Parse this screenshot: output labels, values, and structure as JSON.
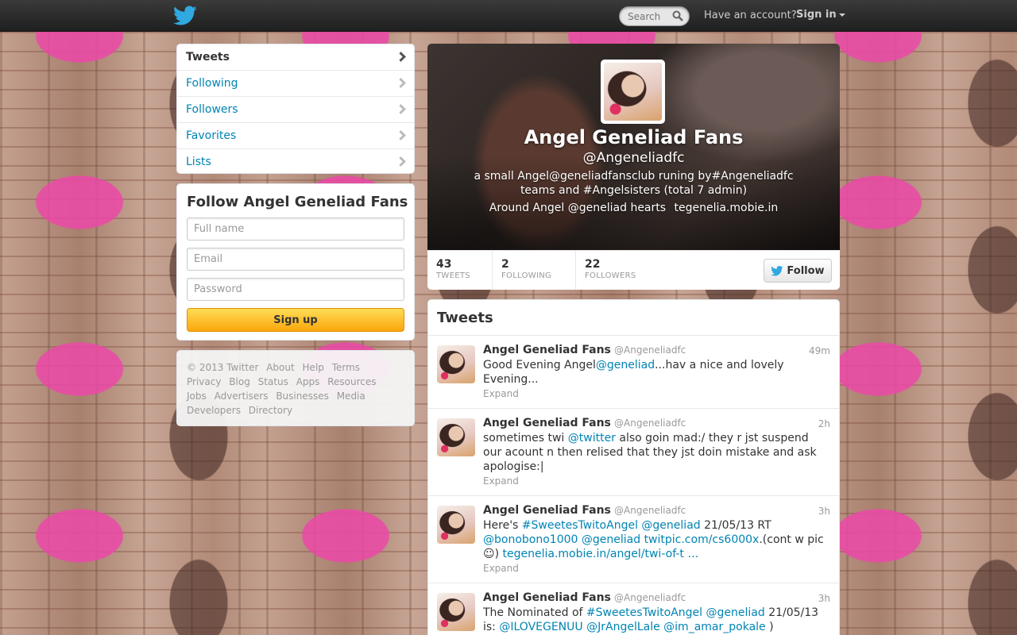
{
  "topbar": {
    "search_placeholder": "Search",
    "have_account": "Have an account?",
    "sign_in": "Sign in"
  },
  "nav": {
    "items": [
      {
        "label": "Tweets"
      },
      {
        "label": "Following"
      },
      {
        "label": "Followers"
      },
      {
        "label": "Favorites"
      },
      {
        "label": "Lists"
      }
    ]
  },
  "signup": {
    "title": "Follow Angel Geneliad Fans",
    "fullname_placeholder": "Full name",
    "email_placeholder": "Email",
    "password_placeholder": "Password",
    "button": "Sign up"
  },
  "footer": {
    "links": [
      "© 2013 Twitter",
      "About",
      "Help",
      "Terms",
      "Privacy",
      "Blog",
      "Status",
      "Apps",
      "Resources",
      "Jobs",
      "Advertisers",
      "Businesses",
      "Media",
      "Developers",
      "Directory"
    ]
  },
  "profile": {
    "name": "Angel Geneliad Fans",
    "handle": "@Angeneliadfc",
    "bio": "a small Angel@geneliadfansclub runing by#Angeneliadfc teams and #Angelsisters (total 7 admin)",
    "location": "Around Angel @geneliad hearts",
    "website": "tegenelia.mobie.in",
    "stats": [
      {
        "num": "43",
        "label": "TWEETS"
      },
      {
        "num": "2",
        "label": "FOLLOWING"
      },
      {
        "num": "22",
        "label": "FOLLOWERS"
      }
    ],
    "follow_button": "Follow"
  },
  "tweets": {
    "title": "Tweets",
    "items": [
      {
        "name": "Angel Geneliad Fans",
        "screen": "@Angeneliadfc",
        "time": "49m",
        "parts": [
          {
            "t": "Good Evening Angel"
          },
          {
            "t": "@geneliad",
            "link": true
          },
          {
            "t": "...hav a nice and lovely Evening..."
          }
        ],
        "expand": "Expand"
      },
      {
        "name": "Angel Geneliad Fans",
        "screen": "@Angeneliadfc",
        "time": "2h",
        "parts": [
          {
            "t": "sometimes twi "
          },
          {
            "t": "@twitter",
            "link": true
          },
          {
            "t": " also goin mad:/ they r jst suspend our acount n then relised that they jst doin mistake and ask apologise:|"
          }
        ],
        "expand": "Expand"
      },
      {
        "name": "Angel Geneliad Fans",
        "screen": "@Angeneliadfc",
        "time": "3h",
        "parts": [
          {
            "t": "Here's "
          },
          {
            "t": "#SweetesTwitoAngel",
            "link": true
          },
          {
            "t": " "
          },
          {
            "t": "@geneliad",
            "link": true
          },
          {
            "t": " 21/05/13 RT "
          },
          {
            "t": "@bonobono1000",
            "link": true
          },
          {
            "t": " "
          },
          {
            "t": "@geneliad",
            "link": true
          },
          {
            "t": " "
          },
          {
            "t": "twitpic.com/cs6000x",
            "link": true
          },
          {
            "t": ".(cont w pic☺) "
          },
          {
            "t": "tegenelia.mobie.in/angel/twi-of-t …",
            "link": true
          }
        ],
        "expand": "Expand"
      },
      {
        "name": "Angel Geneliad Fans",
        "screen": "@Angeneliadfc",
        "time": "3h",
        "parts": [
          {
            "t": "The Nominated of "
          },
          {
            "t": "#SweetesTwitoAngel",
            "link": true
          },
          {
            "t": " "
          },
          {
            "t": "@geneliad",
            "link": true
          },
          {
            "t": " 21/05/13 is: "
          },
          {
            "t": "@ILOVEGENUU",
            "link": true
          },
          {
            "t": " "
          },
          {
            "t": "@JrAngelLale",
            "link": true
          },
          {
            "t": " "
          },
          {
            "t": "@im_amar_pokale",
            "link": true
          },
          {
            "t": " )"
          }
        ],
        "expand": ""
      }
    ]
  },
  "colors": {
    "link": "#0084b4",
    "twitter_blue": "#2fa9e0",
    "signup_yellow": "#f9a60c"
  }
}
